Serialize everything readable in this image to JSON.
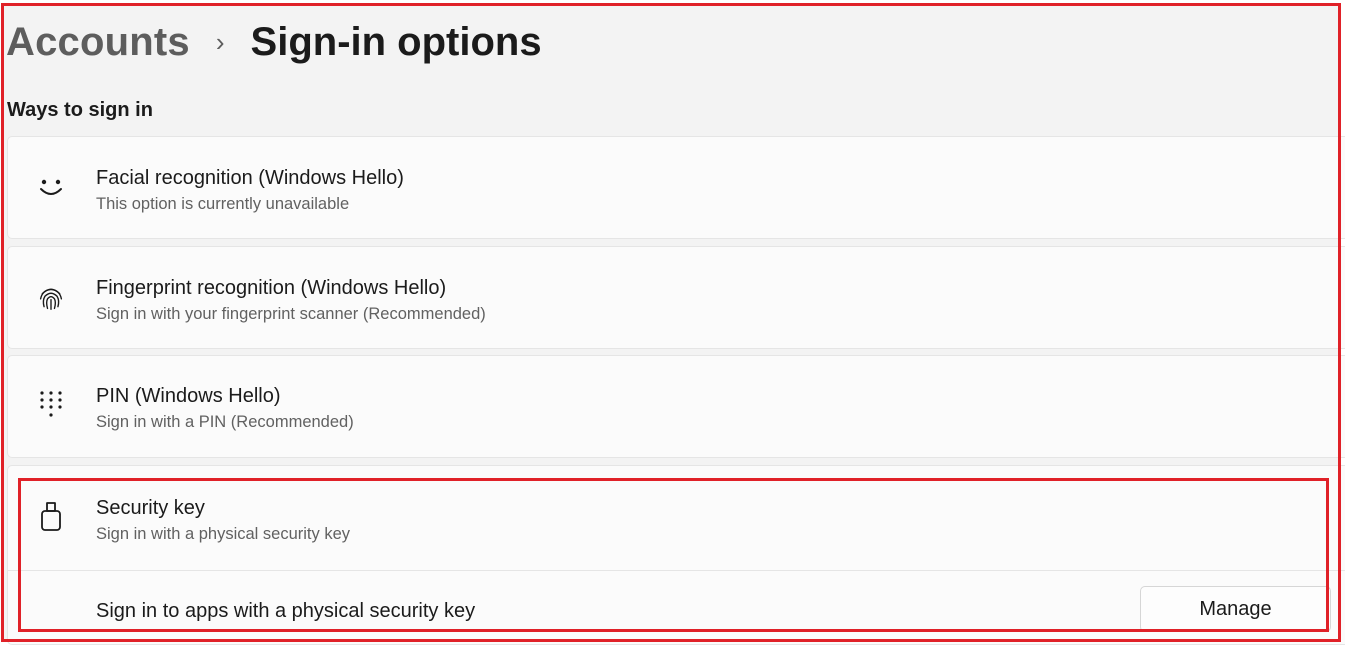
{
  "breadcrumb": {
    "parent": "Accounts",
    "separator": "›",
    "current": "Sign-in options"
  },
  "section_title": "Ways to sign in",
  "options": [
    {
      "title": "Facial recognition (Windows Hello)",
      "subtitle": "This option is currently unavailable",
      "icon": "face-smile-icon"
    },
    {
      "title": "Fingerprint recognition (Windows Hello)",
      "subtitle": "Sign in with your fingerprint scanner (Recommended)",
      "icon": "fingerprint-icon"
    },
    {
      "title": "PIN (Windows Hello)",
      "subtitle": "Sign in with a PIN (Recommended)",
      "icon": "keypad-icon"
    },
    {
      "title": "Security key",
      "subtitle": "Sign in with a physical security key",
      "icon": "usb-key-icon"
    }
  ],
  "security_key_detail": {
    "label": "Sign in to apps with a physical security key",
    "button": "Manage"
  },
  "colors": {
    "background": "#f3f3f3",
    "card": "#fbfbfb",
    "highlight": "#e02128"
  }
}
